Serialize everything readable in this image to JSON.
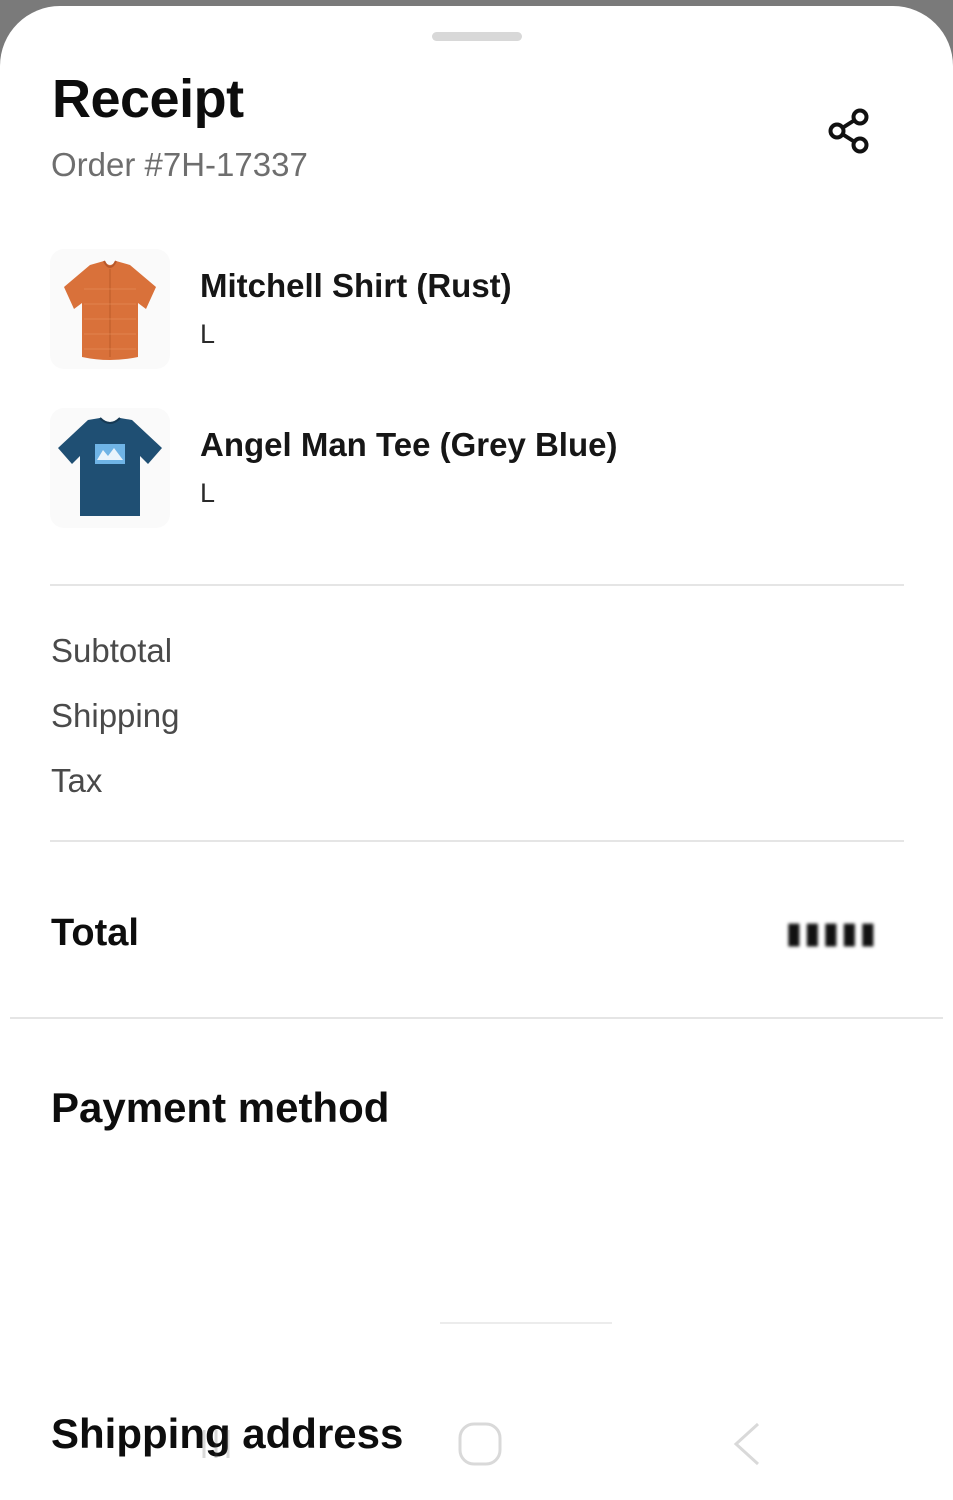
{
  "header": {
    "title": "Receipt",
    "order_number": "Order #7H-17337"
  },
  "items": [
    {
      "name": "Mitchell Shirt (Rust)",
      "size": "L",
      "image_icon": "shirt-rust-image"
    },
    {
      "name": "Angel Man Tee (Grey Blue)",
      "size": "L",
      "image_icon": "tee-grey-blue-image"
    }
  ],
  "summary": {
    "subtotal_label": "Subtotal",
    "shipping_label": "Shipping",
    "tax_label": "Tax",
    "total_label": "Total"
  },
  "sections": {
    "payment_method": "Payment method",
    "shipping_address": "Shipping address"
  },
  "colors": {
    "background": "#ffffff",
    "primary_text": "#0d0d0d",
    "secondary_text": "#6e6e6e",
    "rust": "#d9713a",
    "grey_blue": "#1f4f73"
  }
}
